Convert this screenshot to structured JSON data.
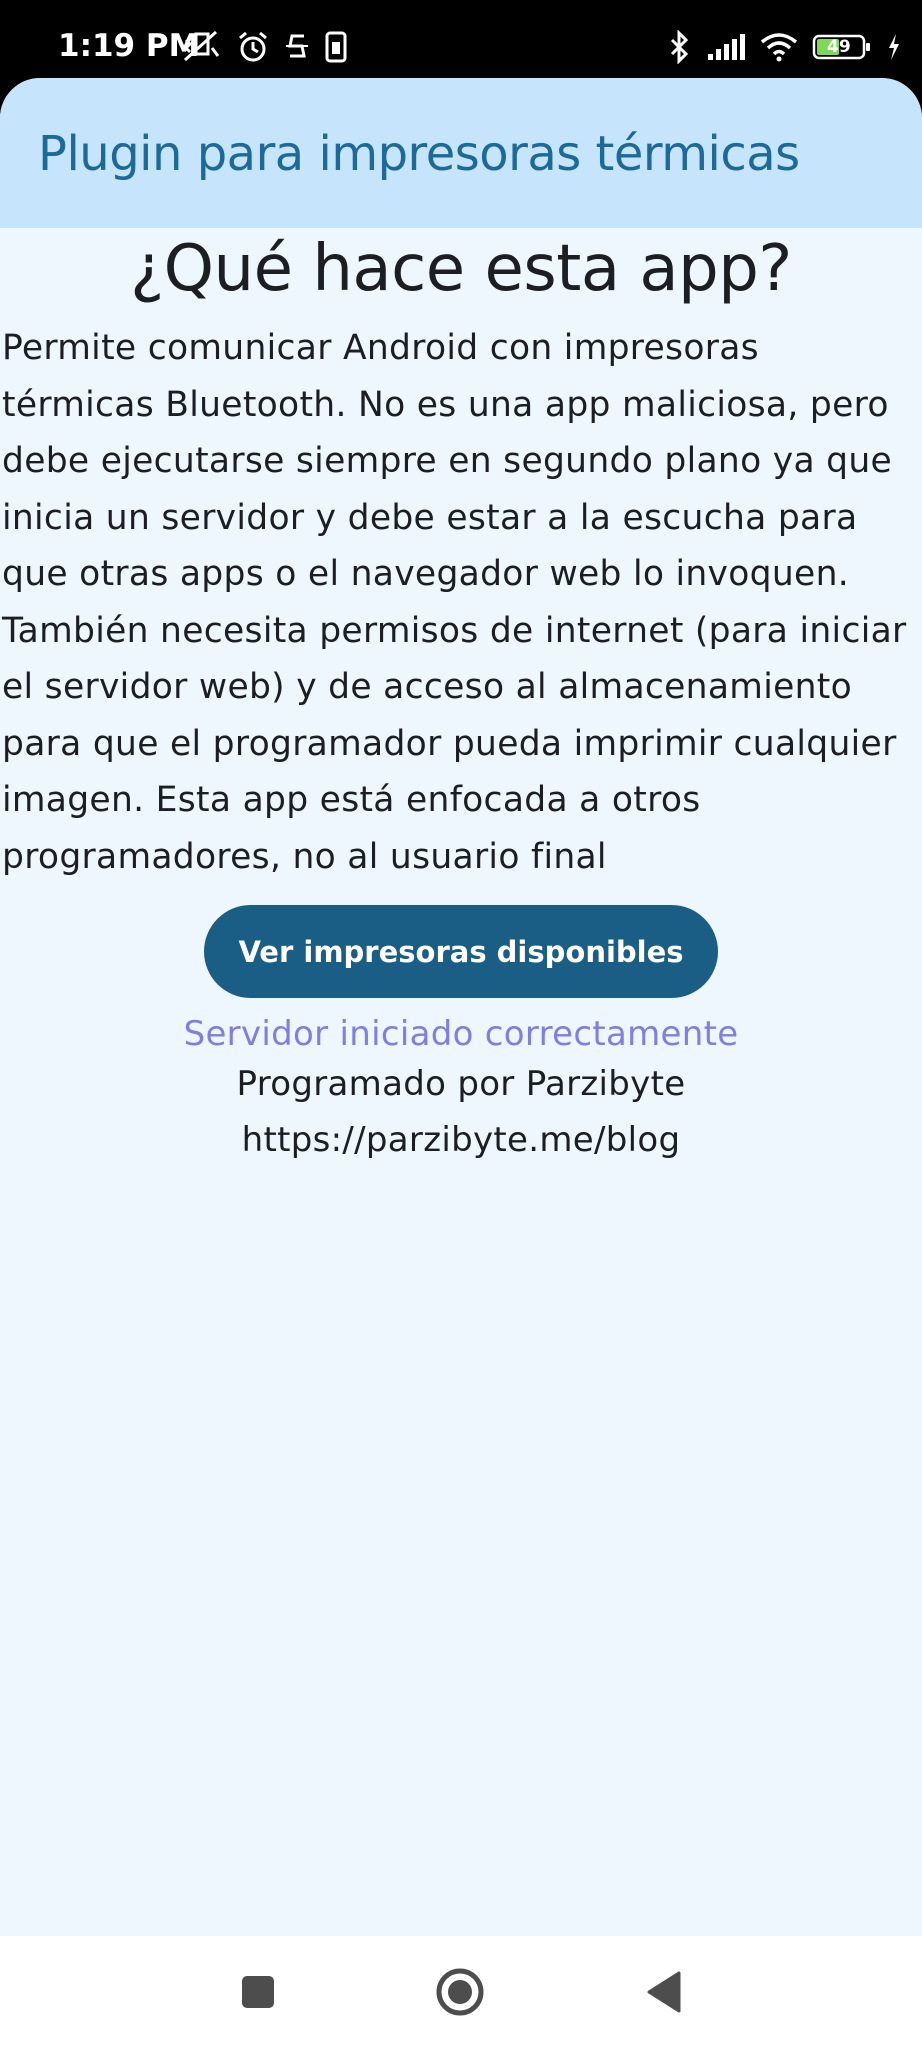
{
  "status_bar": {
    "time": "1:19 PM",
    "battery_level": "49",
    "left_icons": [
      "mute-vibrate-icon",
      "alarm-icon",
      "app-notification-icon",
      "sim-card-icon"
    ],
    "right_icons": [
      "bluetooth-icon",
      "signal-icon",
      "wifi-icon",
      "battery-icon",
      "charging-icon"
    ]
  },
  "app_bar": {
    "title": "Plugin para impresoras térmicas"
  },
  "main": {
    "heading": "¿Qué hace esta app?",
    "description": "Permite comunicar Android con impresoras térmicas Bluetooth. No es una app maliciosa, pero debe ejecutarse siempre en segundo plano ya que inicia un servidor y debe estar a la escucha para que otras apps o el navegador web lo invoquen. También necesita permisos de internet (para iniciar el servidor web) y de acceso al almacenamiento para que el programador pueda imprimir cualquier imagen. Esta app está enfocada a otros programadores, no al usuario final",
    "button_label": "Ver impresoras disponibles",
    "status_message": "Servidor iniciado correctamente",
    "credit": "Programado por Parzibyte",
    "link": "https://parzibyte.me/blog"
  },
  "nav_bar": {
    "buttons": [
      "recents-button",
      "home-button",
      "back-button"
    ]
  },
  "colors": {
    "app_bar_bg": "#c6e4fb",
    "app_bar_title": "#1c6a98",
    "background": "#eff7fe",
    "button": "#1a5e85",
    "status_message": "#7f7fe0",
    "text": "#1b1f24"
  }
}
